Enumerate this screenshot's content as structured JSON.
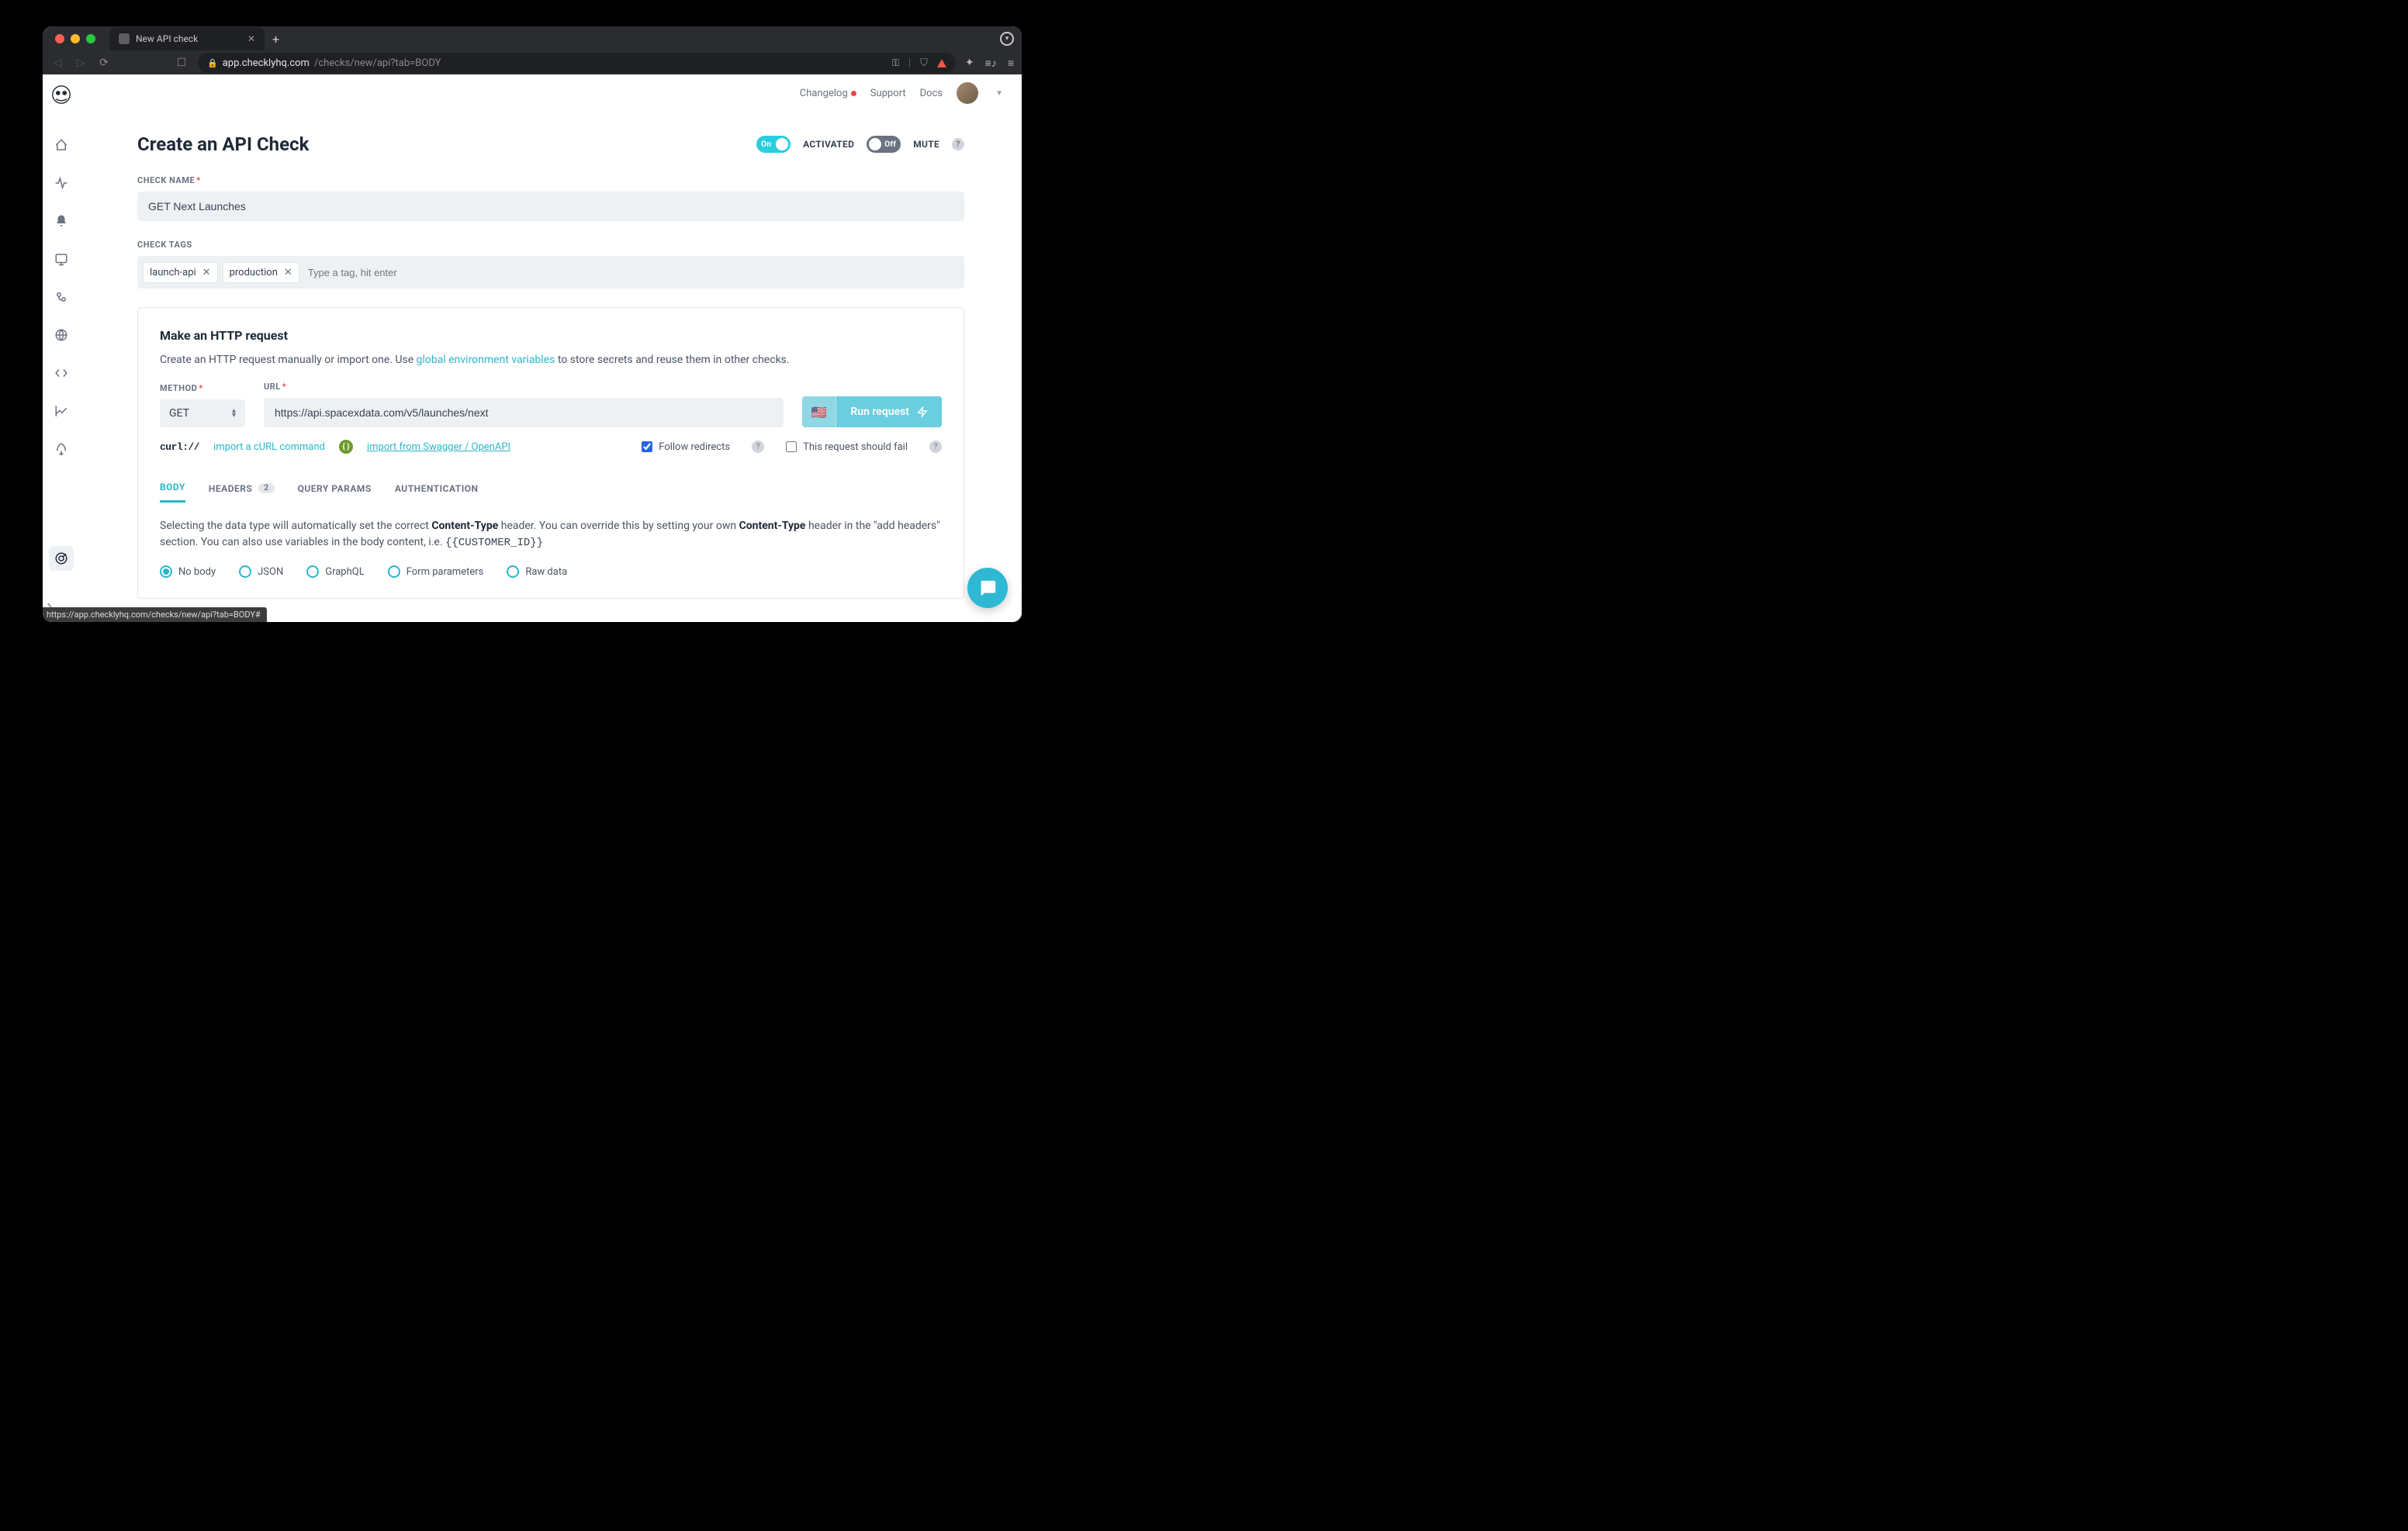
{
  "browser": {
    "tab_title": "New API check",
    "url_domain": "app.checklyhq.com",
    "url_path": "/checks/new/api?tab=BODY",
    "status_tooltip": "https://app.checklyhq.com/checks/new/api?tab=BODY#"
  },
  "topbar": {
    "changelog": "Changelog",
    "support": "Support",
    "docs": "Docs"
  },
  "page": {
    "title": "Create an API Check",
    "activated_toggle": "On",
    "activated_label": "ACTIVATED",
    "mute_toggle": "Off",
    "mute_label": "MUTE"
  },
  "checkName": {
    "label": "CHECK NAME",
    "value": "GET Next Launches"
  },
  "checkTags": {
    "label": "CHECK TAGS",
    "items": [
      "launch-api",
      "production"
    ],
    "placeholder": "Type a tag, hit enter"
  },
  "http": {
    "title": "Make an HTTP request",
    "desc_prefix": "Create an HTTP request manually or import one. Use ",
    "desc_link": "global environment variables",
    "desc_suffix": " to store secrets and reuse them in other checks.",
    "method_label": "METHOD",
    "method_value": "GET",
    "url_label": "URL",
    "url_value": "https://api.spacexdata.com/v5/launches/next",
    "run_button": "Run request",
    "flag": "🇺🇸",
    "curl_label": "curl://",
    "curl_action": "import a cURL command",
    "swagger_action": " import from Swagger / OpenAPI",
    "follow_redirects": "Follow redirects",
    "should_fail": "This request should fail"
  },
  "tabs": {
    "body": "BODY",
    "headers": "HEADERS",
    "headers_count": "2",
    "query": "QUERY PARAMS",
    "auth": "AUTHENTICATION"
  },
  "bodySection": {
    "desc_p1": "Selecting the data type will automatically set the correct ",
    "ct": "Content-Type",
    "desc_p2": " header. You can override this by setting your own ",
    "desc_p3": " header in the \"add headers\" section. You can also use variables in the body content, i.e. ",
    "code": "{{CUSTOMER_ID}}",
    "options": [
      "No body",
      "JSON",
      "GraphQL",
      "Form parameters",
      "Raw data"
    ],
    "selected": 0
  }
}
